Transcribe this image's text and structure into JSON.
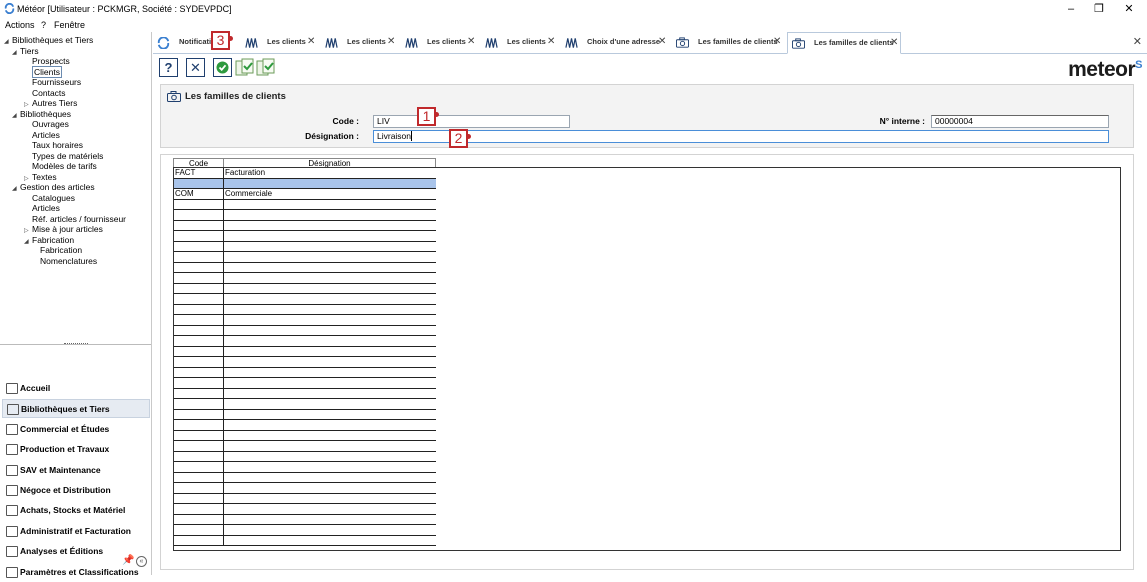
{
  "window": {
    "title": "Météor [Utilisateur : PCKMGR, Société : SYDEVPDC]",
    "minimize": "–",
    "restore": "❐",
    "close": "✕"
  },
  "menu": [
    "Actions",
    "?",
    "Fenêtre"
  ],
  "tree": [
    {
      "label": "Bibliothèques et Tiers",
      "level": 0,
      "arrow": "◢"
    },
    {
      "label": "Tiers",
      "level": 1,
      "arrow": "◢"
    },
    {
      "label": "Prospects",
      "level": 2,
      "arrow": ""
    },
    {
      "label": "Clients",
      "level": 2,
      "arrow": "",
      "selected": true
    },
    {
      "label": "Fournisseurs",
      "level": 2,
      "arrow": ""
    },
    {
      "label": "Contacts",
      "level": 2,
      "arrow": ""
    },
    {
      "label": "Autres Tiers",
      "level": 2,
      "arrow": "▷"
    },
    {
      "label": "Bibliothèques",
      "level": 1,
      "arrow": "◢"
    },
    {
      "label": "Ouvrages",
      "level": 2,
      "arrow": ""
    },
    {
      "label": "Articles",
      "level": 2,
      "arrow": ""
    },
    {
      "label": "Taux horaires",
      "level": 2,
      "arrow": ""
    },
    {
      "label": "Types de matériels",
      "level": 2,
      "arrow": ""
    },
    {
      "label": "Modèles de tarifs",
      "level": 2,
      "arrow": ""
    },
    {
      "label": "Textes",
      "level": 2,
      "arrow": "▷"
    },
    {
      "label": "Gestion des articles",
      "level": 1,
      "arrow": "◢"
    },
    {
      "label": "Catalogues",
      "level": 2,
      "arrow": ""
    },
    {
      "label": "Articles",
      "level": 2,
      "arrow": ""
    },
    {
      "label": "Réf. articles / fournisseur",
      "level": 2,
      "arrow": ""
    },
    {
      "label": "Mise à jour articles",
      "level": 2,
      "arrow": "▷"
    },
    {
      "label": "Fabrication",
      "level": 2,
      "arrow": "◢"
    },
    {
      "label": "Fabrication",
      "level": 3,
      "arrow": ""
    },
    {
      "label": "Nomenclatures",
      "level": 3,
      "arrow": ""
    }
  ],
  "modules": [
    {
      "label": "Accueil",
      "icon": "home-icon"
    },
    {
      "label": "Bibliothèques et Tiers",
      "icon": "books-icon",
      "active": true
    },
    {
      "label": "Commercial et Études",
      "icon": "drafting-icon"
    },
    {
      "label": "Production et Travaux",
      "icon": "worker-icon"
    },
    {
      "label": "SAV et Maintenance",
      "icon": "gear-icon"
    },
    {
      "label": "Négoce et Distribution",
      "icon": "catalog-icon"
    },
    {
      "label": "Achats, Stocks et Matériel",
      "icon": "cart-icon"
    },
    {
      "label": "Administratif et Facturation",
      "icon": "admin-icon"
    },
    {
      "label": "Analyses et Éditions",
      "icon": "report-icon"
    },
    {
      "label": "Paramètres et Classifications",
      "icon": "camera-icon"
    }
  ],
  "tabs": [
    {
      "label": "Notificati",
      "icon": "meteor-icon"
    },
    {
      "label": "Les clients",
      "icon": "books-icon"
    },
    {
      "label": "Les clients",
      "icon": "books-icon"
    },
    {
      "label": "Les clients",
      "icon": "books-icon"
    },
    {
      "label": "Les clients",
      "icon": "books-icon"
    },
    {
      "label": "Choix d'une adresse",
      "icon": "books-icon"
    },
    {
      "label": "Les familles de clients",
      "icon": "camera-icon"
    },
    {
      "label": "Les familles de clients",
      "icon": "camera-icon",
      "active": true
    }
  ],
  "toolbar": {
    "help": "?",
    "cancel": "✕",
    "validate": "✓",
    "logo": "meteor"
  },
  "form": {
    "title": "Les familles de clients",
    "code_label": "Code :",
    "code_value": "LIV",
    "designation_label": "Désignation :",
    "designation_value": "Livraison",
    "numero_label": "N° interne :",
    "numero_value": "00000004"
  },
  "markers": [
    "1",
    "2",
    "3"
  ],
  "grid": {
    "columns": [
      "Code",
      "Désignation"
    ],
    "rows": [
      {
        "code": "FACT",
        "designation": "Facturation"
      },
      {
        "code": "",
        "designation": "",
        "selected": true
      },
      {
        "code": "COM",
        "designation": "Commerciale"
      }
    ]
  },
  "colors": {
    "accent": "#3a7fd0",
    "marker": "#c0292c",
    "selected_row": "#a9c4ea",
    "navy": "#1f3f6e"
  }
}
